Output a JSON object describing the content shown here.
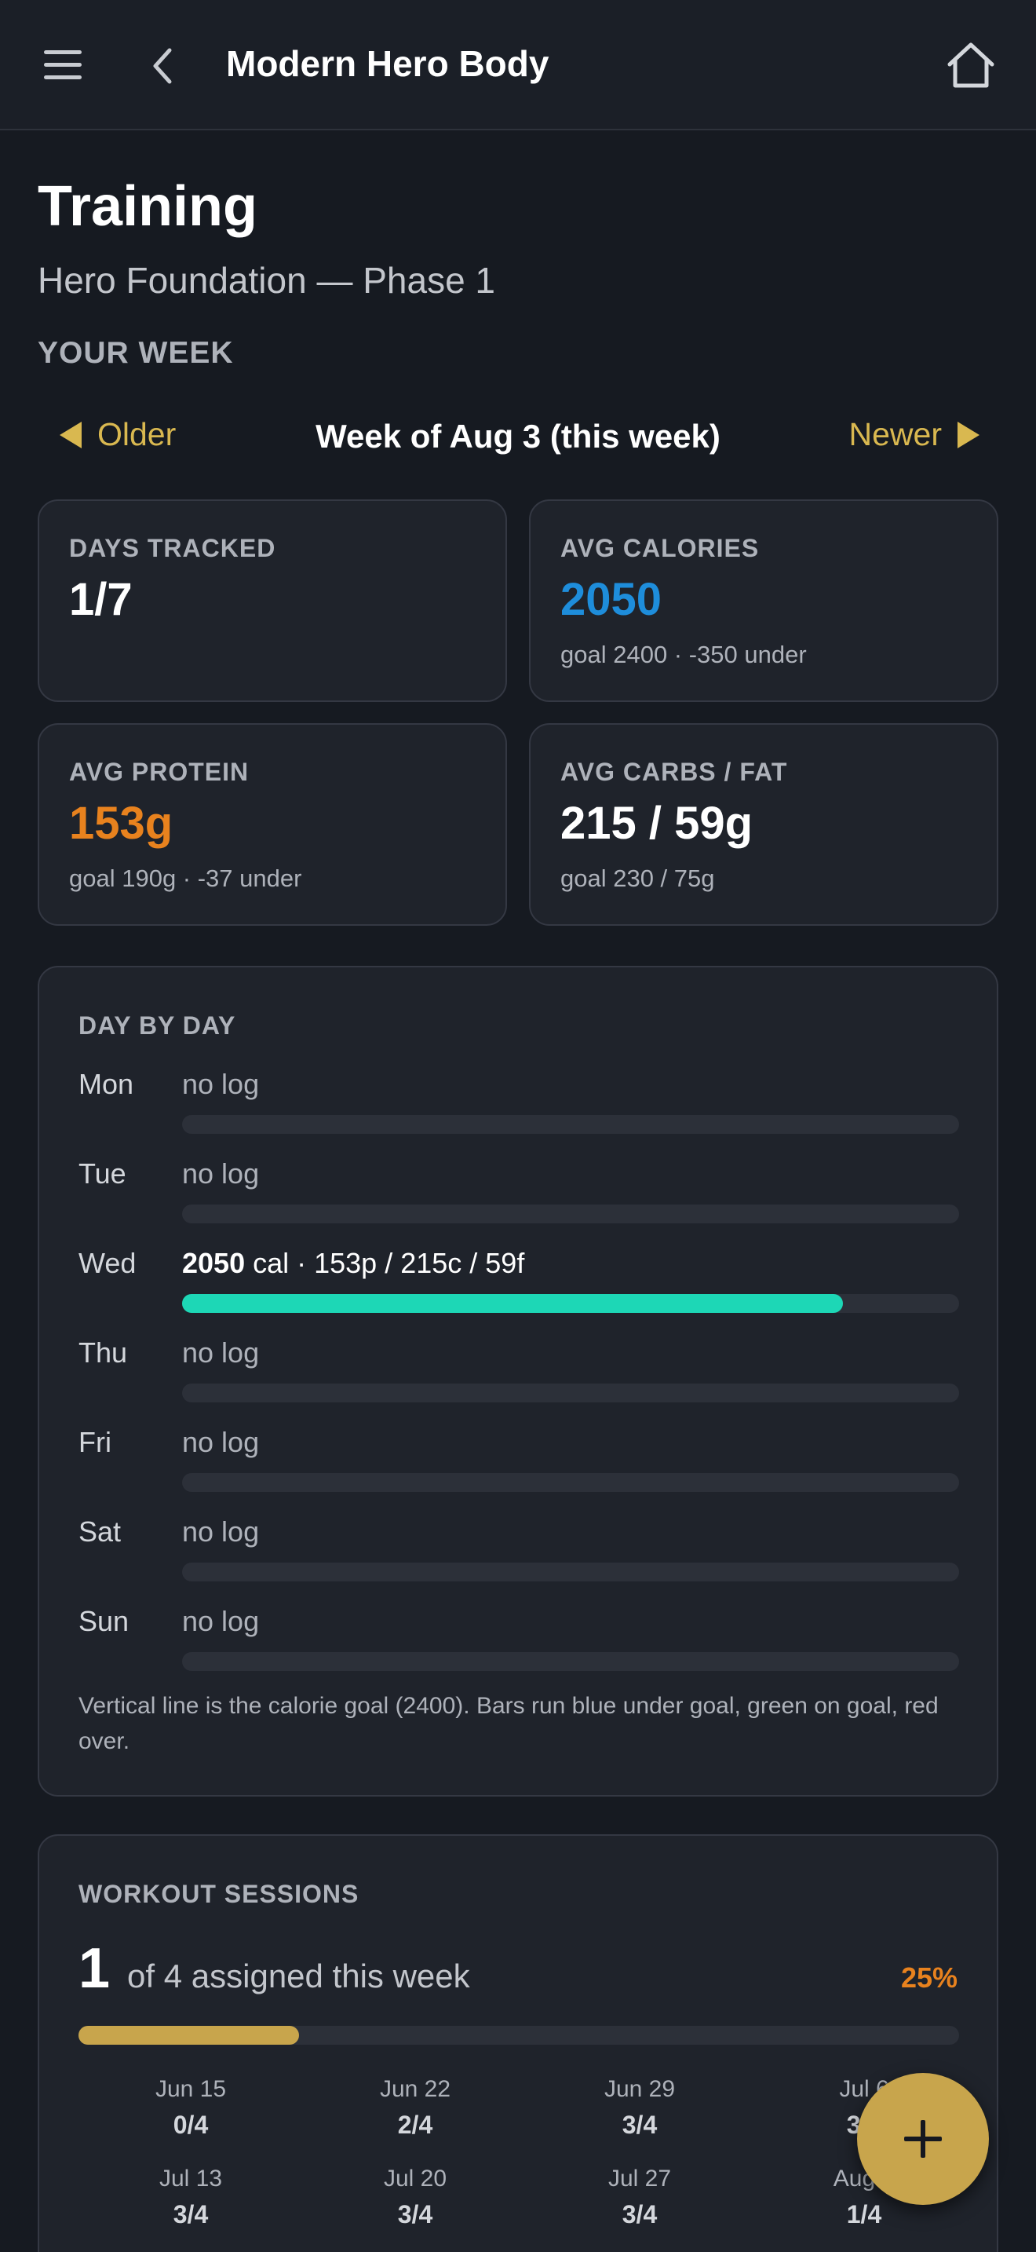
{
  "header": {
    "app_title": "Modern Hero Body",
    "icons": {
      "menu": "hamburger-icon",
      "back": "chevron-left-icon",
      "home": "home-icon"
    }
  },
  "page": {
    "title": "Training",
    "program": "Hero Foundation — Phase 1",
    "section": "YOUR WEEK"
  },
  "week_nav": {
    "older_label": "Older",
    "newer_label": "Newer",
    "current": "Week of Aug 3 (this week)"
  },
  "stats": {
    "days_tracked": {
      "label": "DAYS TRACKED",
      "value": "1/7"
    },
    "avg_calories": {
      "label": "AVG CALORIES",
      "value": "2050",
      "sub": "goal 2400 · -350 under",
      "color": "#1e8ddb"
    },
    "avg_protein": {
      "label": "AVG PROTEIN",
      "value": "153g",
      "sub": "goal 190g · -37 under",
      "color": "#e8821e"
    },
    "avg_carbs_fat": {
      "label": "AVG CARBS / FAT",
      "value": "215 / 59g",
      "sub": "goal 230 / 75g"
    }
  },
  "day_by_day": {
    "title": "DAY BY DAY",
    "calorie_goal": 2400,
    "bar_color": "#1dd7b6",
    "days": [
      {
        "day": "Mon",
        "text": "no log",
        "logged": false
      },
      {
        "day": "Tue",
        "text": "no log",
        "logged": false
      },
      {
        "day": "Wed",
        "logged": true,
        "calories": "2050",
        "calories_unit": " cal · ",
        "macros": "153p / 215c / 59f",
        "fill": 0.85
      },
      {
        "day": "Thu",
        "text": "no log",
        "logged": false
      },
      {
        "day": "Fri",
        "text": "no log",
        "logged": false
      },
      {
        "day": "Sat",
        "text": "no log",
        "logged": false
      },
      {
        "day": "Sun",
        "text": "no log",
        "logged": false
      }
    ],
    "note": "Vertical line is the calorie goal (2400). Bars run blue under goal, green on goal, red over."
  },
  "workouts": {
    "title": "WORKOUT SESSIONS",
    "completed": "1",
    "assigned_text": "of 4 assigned this week",
    "percent_label": "25%",
    "progress": 0.25,
    "history": [
      {
        "date": "Jun 15",
        "score": "0/4"
      },
      {
        "date": "Jun 22",
        "score": "2/4"
      },
      {
        "date": "Jun 29",
        "score": "3/4"
      },
      {
        "date": "Jul 6",
        "score": "3/4"
      },
      {
        "date": "Jul 13",
        "score": "3/4"
      },
      {
        "date": "Jul 20",
        "score": "3/4"
      },
      {
        "date": "Jul 27",
        "score": "3/4"
      },
      {
        "date": "Aug 3",
        "score": "1/4"
      }
    ]
  },
  "fab": {
    "icon": "plus-icon"
  }
}
